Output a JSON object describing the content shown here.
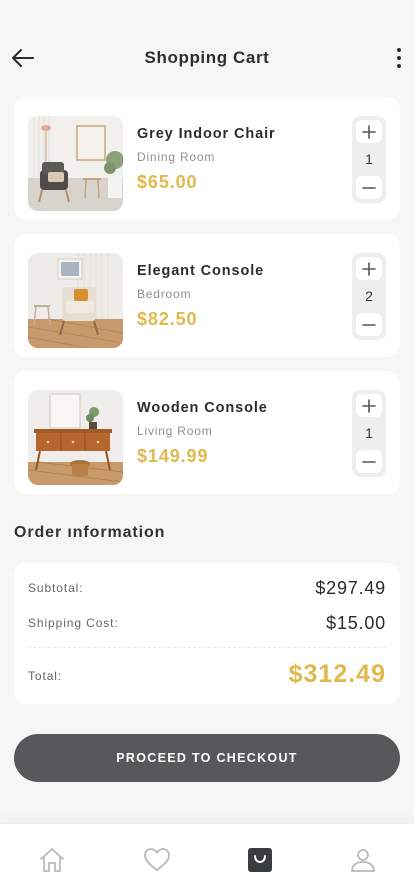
{
  "header": {
    "title": "Shopping Cart",
    "back_icon": "arrow-left-icon",
    "more_icon": "more-vertical-icon"
  },
  "cart": {
    "items": [
      {
        "name": "Grey Indoor Chair",
        "room": "Dining Room",
        "price": "$65.00",
        "quantity": "1",
        "image": "grey-chair-photo"
      },
      {
        "name": "Elegant Console",
        "room": "Bedroom",
        "price": "$82.50",
        "quantity": "2",
        "image": "armchair-photo"
      },
      {
        "name": "Wooden Console",
        "room": "Living Room",
        "price": "$149.99",
        "quantity": "1",
        "image": "wooden-console-photo"
      }
    ],
    "plus_icon": "plus-icon",
    "minus_icon": "minus-icon"
  },
  "order": {
    "title": "Order ınformation",
    "subtotal_label": "Subtotal:",
    "subtotal_value": "$297.49",
    "shipping_label": "Shipping Cost:",
    "shipping_value": "$15.00",
    "total_label": "Total:",
    "total_value": "$312.49"
  },
  "checkout": {
    "label": "PROCEED TO CHECKOUT"
  },
  "tabbar": {
    "items": [
      "home-icon",
      "heart-icon",
      "shopping-bag-icon",
      "user-icon"
    ],
    "active": "shopping-bag-icon"
  },
  "colors": {
    "accent": "#e0b84e",
    "button": "#56595a",
    "background": "#f6f6f6"
  }
}
